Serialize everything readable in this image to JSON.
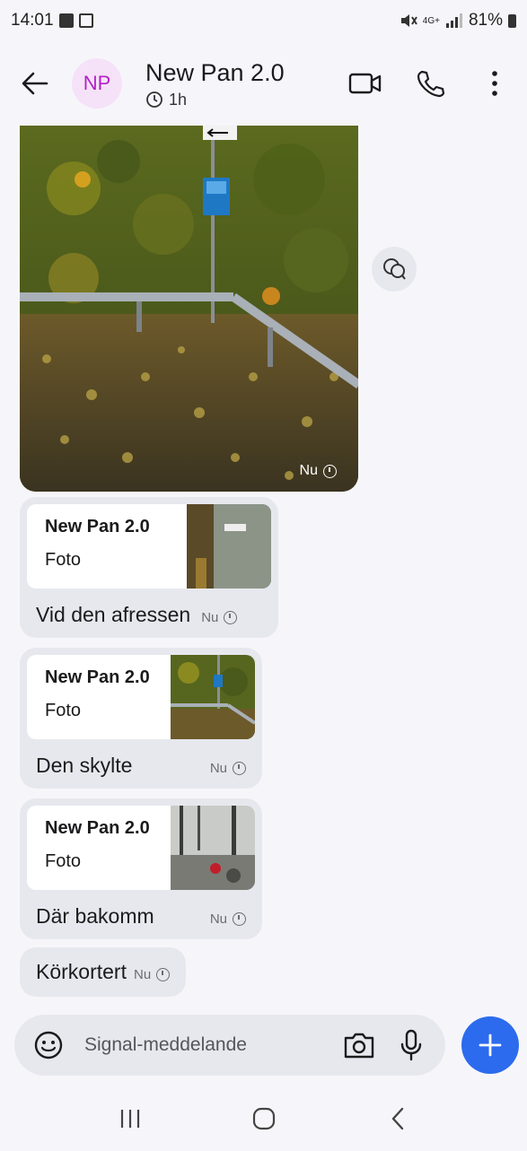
{
  "status_bar": {
    "time": "14:01",
    "battery": "81%",
    "network": "4G+"
  },
  "header": {
    "avatar_initials": "NP",
    "title": "New Pan 2.0",
    "timer": "1h"
  },
  "messages": {
    "photo": {
      "time": "Nu"
    },
    "reply1": {
      "quote_author": "New Pan 2.0",
      "quote_type": "Foto",
      "text": "Vid den afressen",
      "time": "Nu"
    },
    "reply2": {
      "quote_author": "New Pan 2.0",
      "quote_type": "Foto",
      "text": "Den skylte",
      "time": "Nu"
    },
    "reply3": {
      "quote_author": "New Pan 2.0",
      "quote_type": "Foto",
      "text": "Där bakomm",
      "time": "Nu"
    },
    "text4": {
      "text": "Körkortert",
      "time": "Nu"
    }
  },
  "composer": {
    "placeholder": "Signal-meddelande"
  },
  "colors": {
    "accent": "#2c6bed",
    "bubble": "#e7e8ee",
    "avatar_bg": "#f6e2f8",
    "avatar_fg": "#b321c9"
  },
  "icons": {
    "back": "arrow-left-icon",
    "video": "video-camera-icon",
    "call": "phone-icon",
    "more": "more-vertical-icon",
    "reply": "reply-icon",
    "emoji": "emoji-icon",
    "camera": "camera-icon",
    "mic": "microphone-icon",
    "plus": "plus-icon"
  }
}
